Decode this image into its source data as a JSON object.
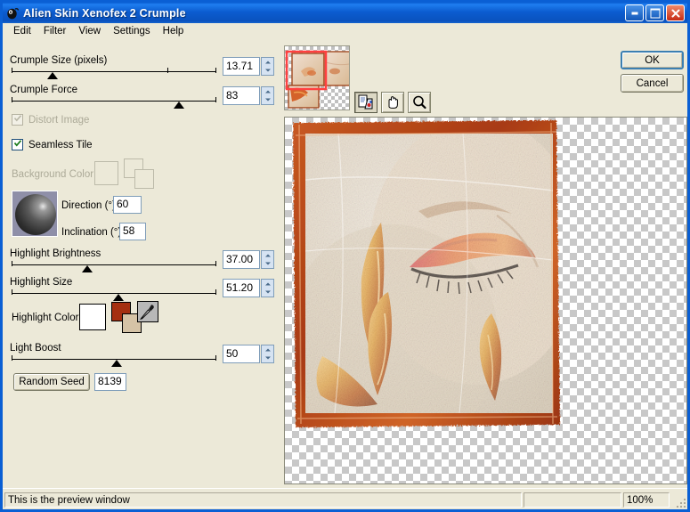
{
  "window": {
    "title": "Alien Skin Xenofex 2 Crumple",
    "icon": "app-icon",
    "buttons": {
      "minimize": "minimize",
      "maximize": "maximize",
      "close": "close"
    }
  },
  "menu": {
    "items": [
      "Edit",
      "Filter",
      "View",
      "Settings",
      "Help"
    ]
  },
  "controls": {
    "crumple_size": {
      "label": "Crumple Size (pixels)",
      "value": "13.71",
      "thumb_pct": 20,
      "tick_pct": 76
    },
    "crumple_force": {
      "label": "Crumple Force",
      "value": "83",
      "thumb_pct": 81,
      "tick_pct": -1
    },
    "distort_image": {
      "label": "Distort Image",
      "checked": true,
      "enabled": false
    },
    "seamless_tile": {
      "label": "Seamless Tile",
      "checked": true,
      "enabled": true
    },
    "background_color": {
      "label": "Background Color",
      "enabled": false
    },
    "direction": {
      "label": "Direction (°)",
      "value": "60"
    },
    "inclination": {
      "label": "Inclination (°)",
      "value": "58"
    },
    "highlight_brightness": {
      "label": "Highlight Brightness",
      "value": "37.00",
      "thumb_pct": 37
    },
    "highlight_size": {
      "label": "Highlight Size",
      "value": "51.20",
      "thumb_pct": 51
    },
    "highlight_color": {
      "label": "Highlight Color",
      "primary": "#ffffff",
      "secondary": "#a52f10",
      "tertiary": "#d5c3a6",
      "eyedropper": "eyedropper-icon"
    },
    "light_boost": {
      "label": "Light Boost",
      "value": "50",
      "thumb_pct": 50
    },
    "random_seed": {
      "label": "Random Seed",
      "value": "8139"
    }
  },
  "toolbar": {
    "compare_label": "compare-view",
    "pan_label": "hand-tool",
    "zoom_label": "zoom-tool"
  },
  "dialog_buttons": {
    "ok": "OK",
    "cancel": "Cancel"
  },
  "statusbar": {
    "message": "This is the preview window",
    "zoom": "100%"
  },
  "colors": {
    "title_blue": "#0a5fd4",
    "face_border": "#b7441a",
    "accent_red": "#a52f10",
    "panel_bg": "#ece9d8"
  }
}
